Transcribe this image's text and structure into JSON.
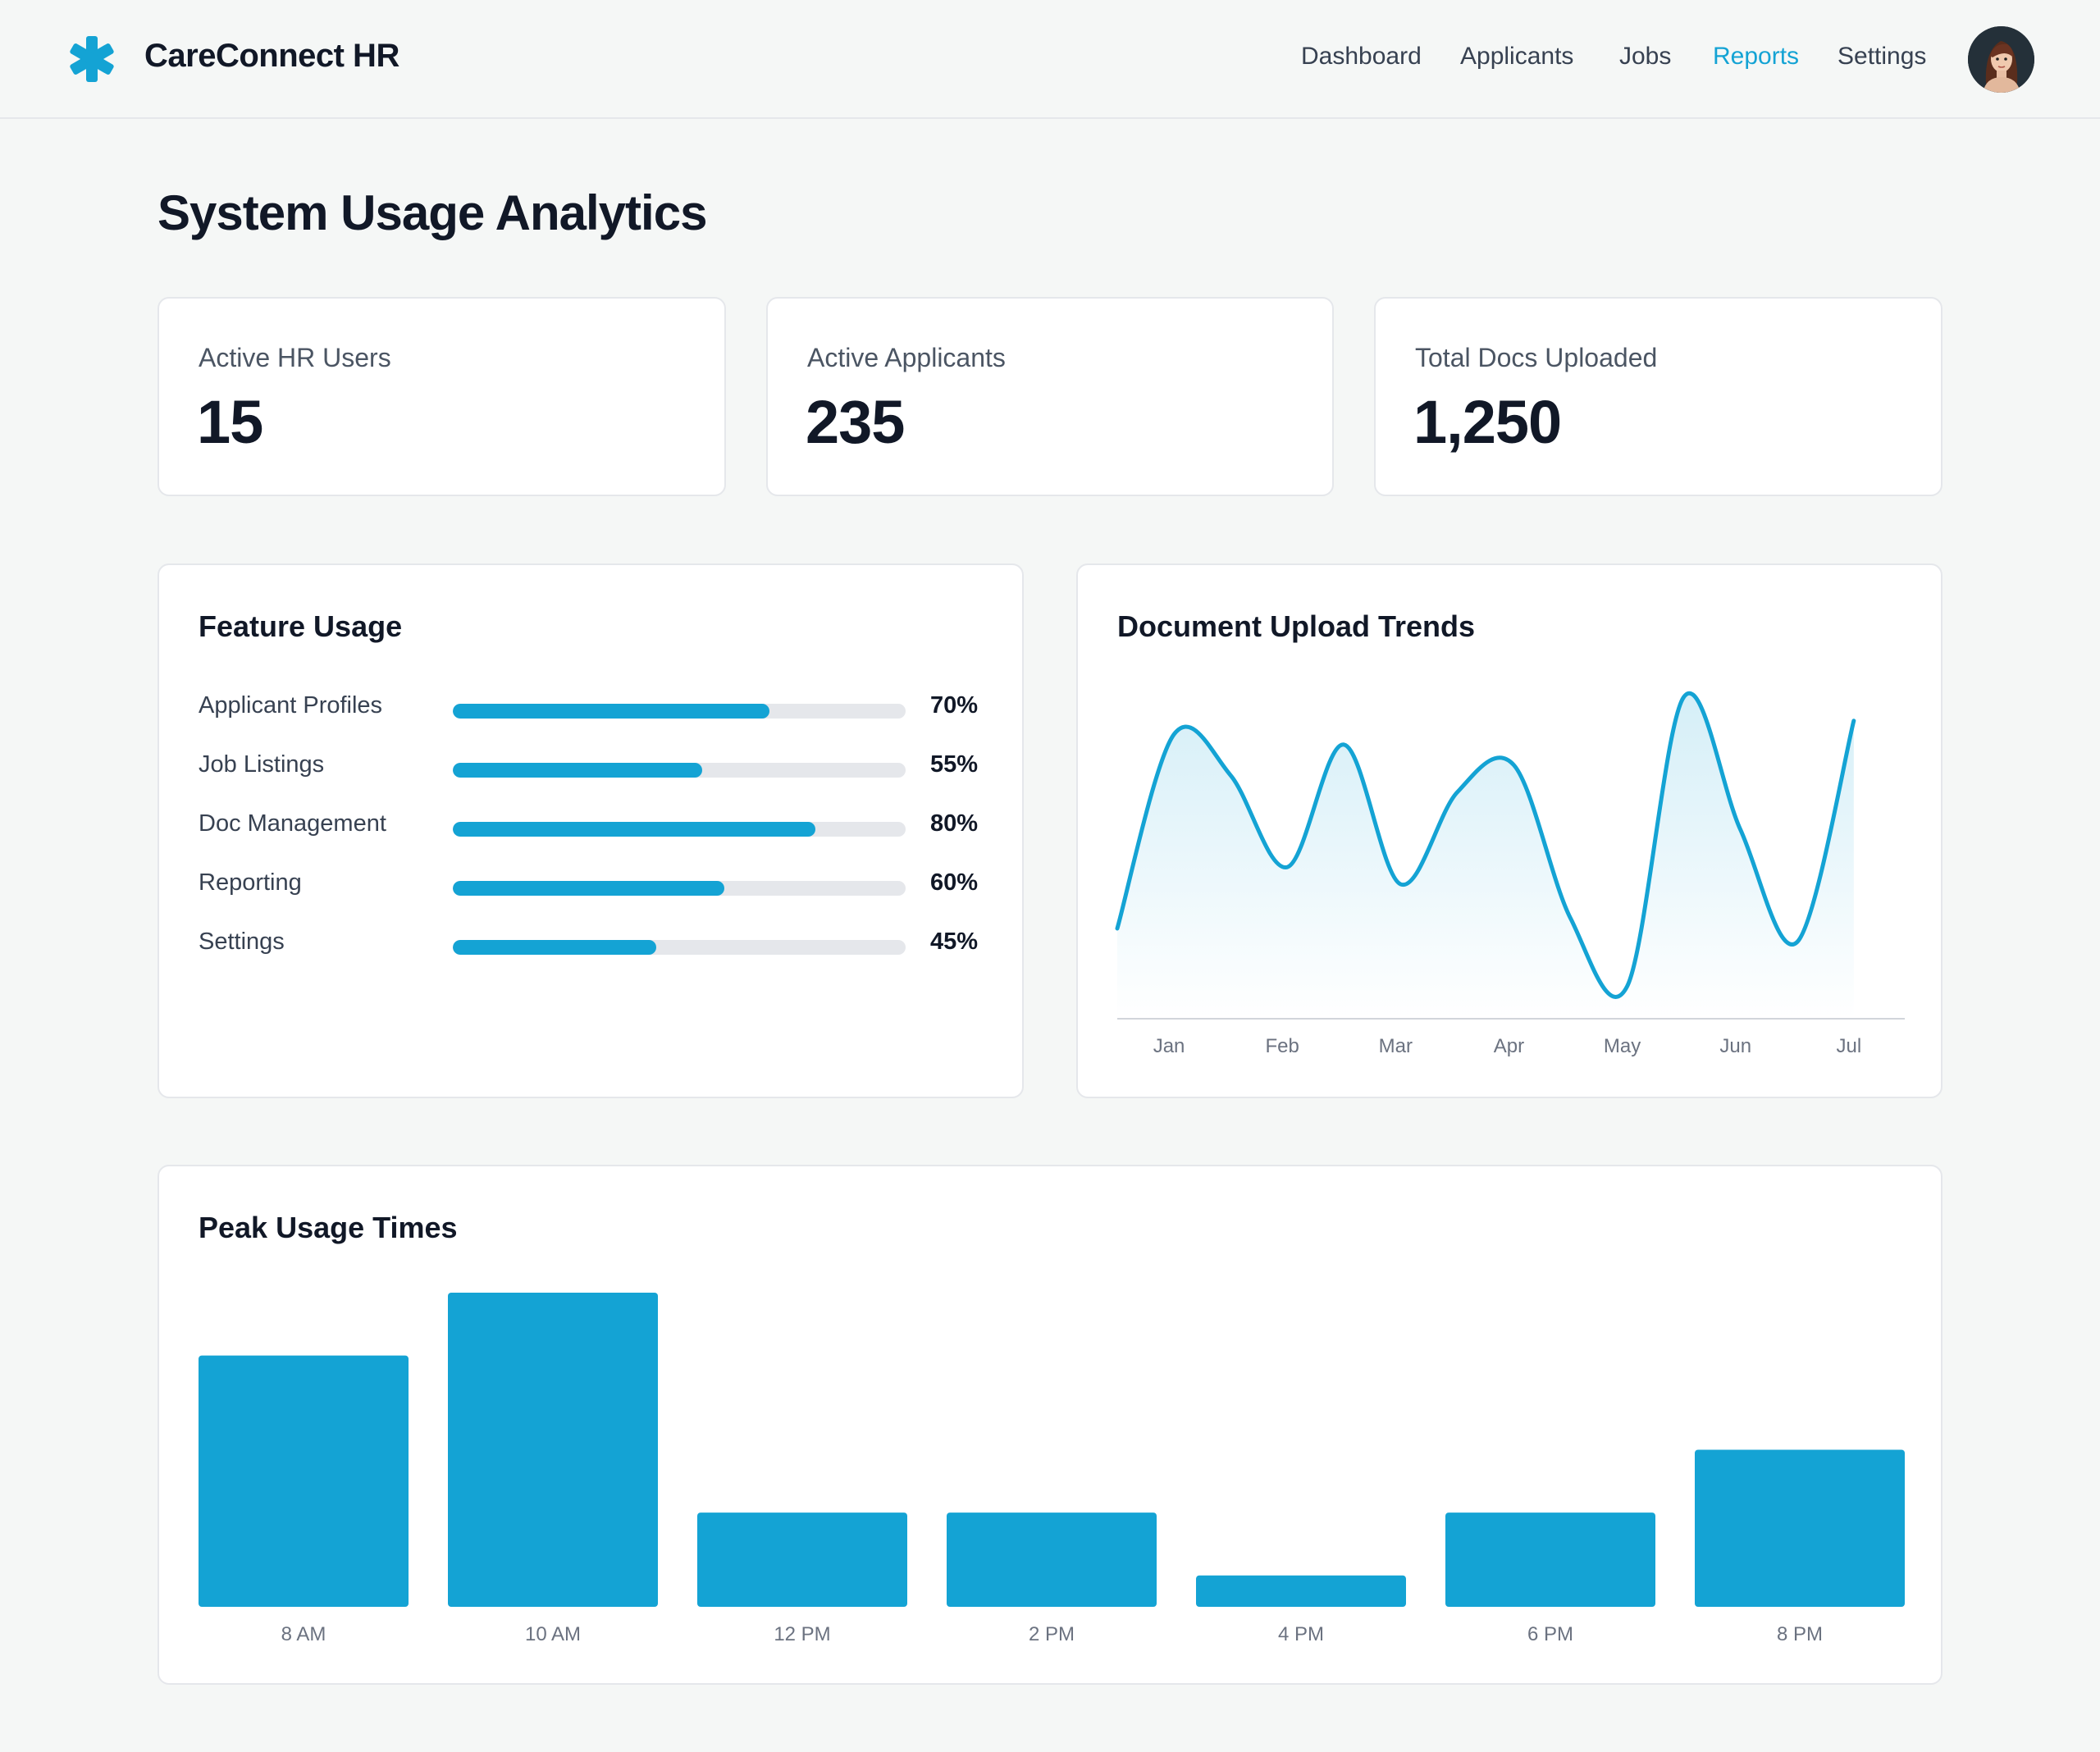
{
  "header": {
    "brand": "CareConnect HR",
    "nav": [
      {
        "label": "Dashboard",
        "active": false
      },
      {
        "label": "Applicants",
        "active": false
      },
      {
        "label": "Jobs",
        "active": false
      },
      {
        "label": "Reports",
        "active": true
      },
      {
        "label": "Settings",
        "active": false
      }
    ],
    "logo_icon": "medical-asterisk-icon",
    "accent_color": "#14a3d4"
  },
  "page": {
    "title": "System Usage Analytics"
  },
  "stats": [
    {
      "label": "Active HR Users",
      "value": "15"
    },
    {
      "label": "Active Applicants",
      "value": "235"
    },
    {
      "label": "Total Docs Uploaded",
      "value": "1,250"
    }
  ],
  "feature_usage": {
    "title": "Feature Usage",
    "items": [
      {
        "label": "Applicant Profiles",
        "pct_label": "70%",
        "value": 70
      },
      {
        "label": "Job Listings",
        "pct_label": "55%",
        "value": 55
      },
      {
        "label": "Doc Management",
        "pct_label": "80%",
        "value": 80
      },
      {
        "label": "Reporting",
        "pct_label": "60%",
        "value": 60
      },
      {
        "label": "Settings",
        "pct_label": "45%",
        "value": 45
      }
    ]
  },
  "chart_data": [
    {
      "type": "area",
      "title": "Document Upload Trends",
      "categories": [
        "Jan",
        "Feb",
        "Mar",
        "Apr",
        "May",
        "Jun",
        "Jul"
      ],
      "x": [
        0,
        0.5,
        1,
        1.5,
        2,
        2.5,
        3,
        3.5,
        4,
        4.5,
        5,
        5.5,
        6,
        6.5,
        7
      ],
      "series": [
        {
          "values": [
            27,
            84,
            72,
            45,
            81,
            40,
            67,
            75,
            30,
            10,
            95,
            56,
            23,
            88
          ]
        }
      ],
      "ylim": [
        0,
        100
      ],
      "grid": false
    },
    {
      "type": "bar",
      "title": "Peak Usage Times",
      "categories": [
        "8 AM",
        "10 AM",
        "12 PM",
        "2 PM",
        "4 PM",
        "6 PM",
        "8 PM"
      ],
      "values": [
        80,
        100,
        30,
        30,
        10,
        30,
        50
      ],
      "ylim": [
        0,
        100
      ],
      "grid": false
    }
  ]
}
